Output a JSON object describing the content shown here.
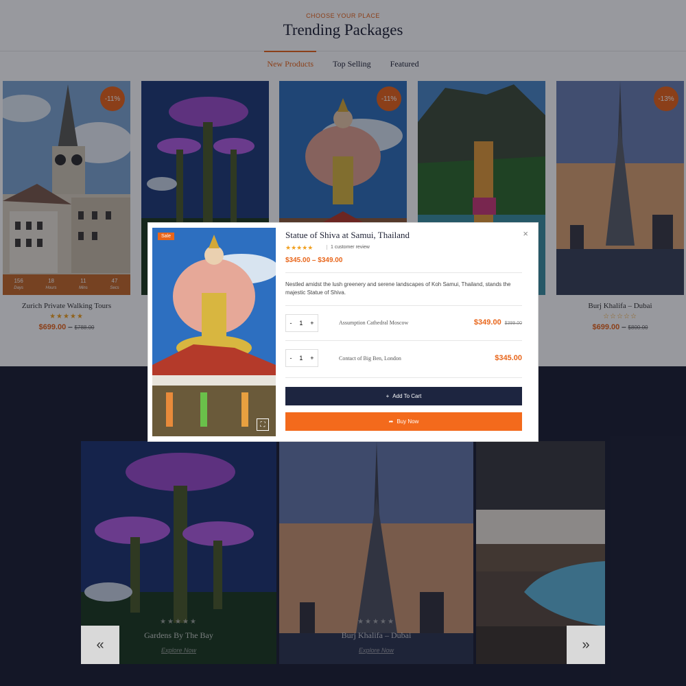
{
  "section": {
    "eyebrow": "CHOOSE YOUR PLACE",
    "title": "Trending Packages",
    "tabs": [
      {
        "label": "New Products",
        "active": true
      },
      {
        "label": "Top Selling",
        "active": false
      },
      {
        "label": "Featured",
        "active": false
      }
    ]
  },
  "cards": [
    {
      "title": "Zurich Private Walking Tours",
      "discount": "-11%",
      "rating_stars": "★★★★★",
      "price": "$699.00",
      "separator": "–",
      "old_price": "$788.00",
      "countdown": [
        {
          "value": "156",
          "unit": "Days"
        },
        {
          "value": "18",
          "unit": "Hours"
        },
        {
          "value": "11",
          "unit": "Mins"
        },
        {
          "value": "47",
          "unit": "Secs"
        }
      ]
    },
    {
      "title": "",
      "discount": ""
    },
    {
      "title": "",
      "discount": "-11%"
    },
    {
      "title": "",
      "discount": ""
    },
    {
      "title": "Burj Khalifa – Dubai",
      "discount": "-13%",
      "rating_stars": "☆☆☆☆☆",
      "price": "$699.00",
      "separator": "–",
      "old_price": "$800.00"
    }
  ],
  "modal": {
    "badge": "Sale",
    "title": "Statue of Shiva at Samui, Thailand",
    "rating_stars": "★★★★★",
    "review_text": "1 customer review",
    "price_range": "$345.00 – $349.00",
    "description": "Nestled amidst the lush greenery and serene landscapes of Koh Samui, Thailand, stands the majestic Statue of Shiva.",
    "items": [
      {
        "qty": "1",
        "minus": "-",
        "plus": "+",
        "name": "Assumption Cathedral Moscow",
        "price": "$349.00",
        "old_price": "$399.00"
      },
      {
        "qty": "1",
        "minus": "-",
        "plus": "+",
        "name": "Contact of Big Ben, London",
        "price": "$345.00"
      }
    ],
    "add_to_cart_label": "Add To Cart",
    "buy_now_label": "Buy Now",
    "close_glyph": "×",
    "expand_glyph": "⛶"
  },
  "carousel": {
    "prev_glyph": "«",
    "next_glyph": "»",
    "items": [
      {
        "title": "Gardens By The Bay",
        "stars": "★★★★★",
        "link": "Explore Now"
      },
      {
        "title": "Burj Khalifa – Dubai",
        "stars": "★★★★★",
        "link": "Explore Now"
      },
      {
        "title": "",
        "stars": "",
        "link": ""
      }
    ]
  },
  "colors": {
    "accent": "#e8651a",
    "navy": "#1d2033",
    "buy": "#f36a1c"
  }
}
